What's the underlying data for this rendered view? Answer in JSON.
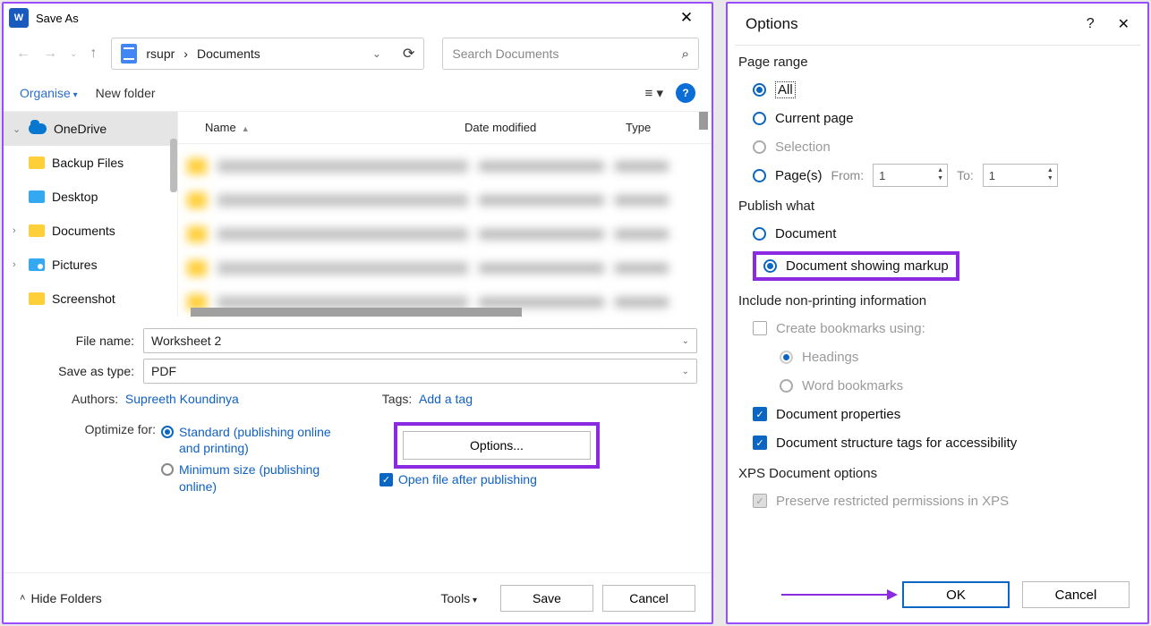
{
  "saveAs": {
    "title": "Save As",
    "breadcrumb": {
      "user": "rsupr",
      "folder": "Documents"
    },
    "search": {
      "placeholder": "Search Documents"
    },
    "toolbar": {
      "organise": "Organise",
      "newFolder": "New folder"
    },
    "sidebar": {
      "items": [
        {
          "label": "OneDrive"
        },
        {
          "label": "Backup Files"
        },
        {
          "label": "Desktop"
        },
        {
          "label": "Documents"
        },
        {
          "label": "Pictures"
        },
        {
          "label": "Screenshot"
        }
      ]
    },
    "columns": {
      "name": "Name",
      "date": "Date modified",
      "type": "Type"
    },
    "fileNameLabel": "File name:",
    "fileName": "Worksheet 2",
    "saveTypeLabel": "Save as type:",
    "saveType": "PDF",
    "authorsLabel": "Authors:",
    "authors": "Supreeth Koundinya",
    "tagsLabel": "Tags:",
    "tagsValue": "Add a tag",
    "optimizeLabel": "Optimize for:",
    "optimize": {
      "standard": "Standard (publishing online and printing)",
      "minimum": "Minimum size (publishing online)"
    },
    "optionsButton": "Options...",
    "openAfter": "Open file after publishing",
    "hideFolders": "Hide Folders",
    "tools": "Tools",
    "save": "Save",
    "cancel": "Cancel"
  },
  "options": {
    "title": "Options",
    "pageRange": {
      "label": "Page range",
      "all": "All",
      "currentPage": "Current page",
      "selection": "Selection",
      "pages": "Page(s)",
      "from": "From:",
      "fromVal": "1",
      "to": "To:",
      "toVal": "1"
    },
    "publishWhat": {
      "label": "Publish what",
      "document": "Document",
      "documentMarkup": "Document showing markup"
    },
    "nonPrinting": {
      "label": "Include non-printing information",
      "createBookmarks": "Create bookmarks using:",
      "headings": "Headings",
      "wordBookmarks": "Word bookmarks",
      "docProps": "Document properties",
      "docTags": "Document structure tags for accessibility"
    },
    "xps": {
      "label": "XPS Document options",
      "preserve": "Preserve restricted permissions in XPS"
    },
    "ok": "OK",
    "cancel": "Cancel"
  }
}
